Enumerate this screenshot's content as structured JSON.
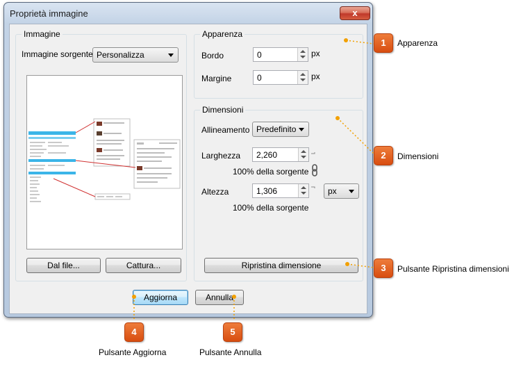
{
  "window": {
    "title": "Proprietà immagine",
    "close_glyph": "x"
  },
  "image_group": {
    "label": "Immagine",
    "source_label": "Immagine sorgente",
    "source_value": "Personalizza",
    "from_file_button": "Dal file...",
    "capture_button": "Cattura..."
  },
  "appearance_group": {
    "label": "Apparenza",
    "border_label": "Bordo",
    "border_value": "0",
    "border_unit": "px",
    "margin_label": "Margine",
    "margin_value": "0",
    "margin_unit": "px"
  },
  "dimensions_group": {
    "label": "Dimensioni",
    "align_label": "Allineamento",
    "align_value": "Predefinito",
    "width_label": "Larghezza",
    "width_value": "2,260",
    "width_percent": "100% della sorgente",
    "height_label": "Altezza",
    "height_value": "1,306",
    "height_percent": "100% della sorgente",
    "unit_value": "px",
    "reset_button": "Ripristina dimensione"
  },
  "footer": {
    "update_button": "Aggiorna",
    "cancel_button": "Annulla"
  },
  "callouts": [
    {
      "number": "1",
      "text": "Apparenza"
    },
    {
      "number": "2",
      "text": "Dimensioni"
    },
    {
      "number": "3",
      "text": "Pulsante Ripristina dimensioni"
    },
    {
      "number": "4",
      "text": "Pulsante Aggiorna"
    },
    {
      "number": "5",
      "text": "Pulsante Annulla"
    }
  ],
  "colors": {
    "callout_accent": "#e0621f",
    "callout_dot": "#f2a000",
    "window_frame": "#c3d3e6"
  },
  "icons": {
    "link": "chain-link-icon"
  }
}
